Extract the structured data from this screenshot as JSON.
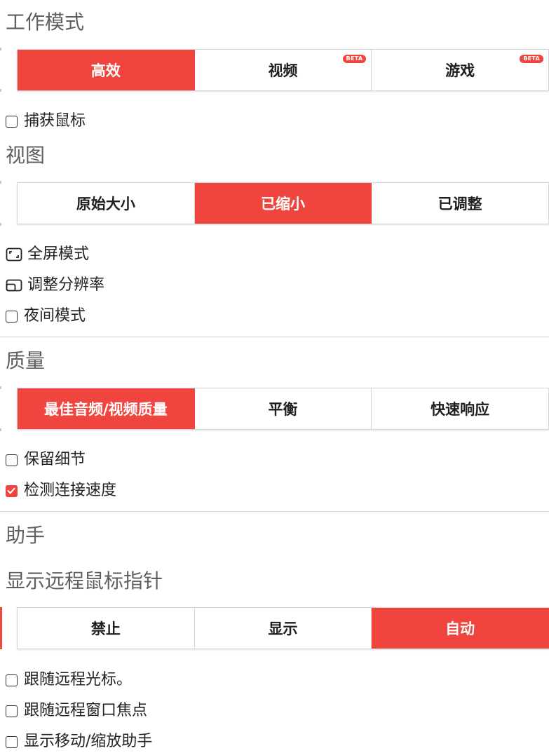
{
  "sections": {
    "work_mode": {
      "title": "工作模式",
      "options": [
        {
          "label": "高效",
          "active": true,
          "badge": ""
        },
        {
          "label": "视频",
          "active": false,
          "badge": "BETA"
        },
        {
          "label": "游戏",
          "active": false,
          "badge": "BETA"
        }
      ],
      "checkboxes": [
        {
          "label": "捕获鼠标",
          "checked": false
        }
      ]
    },
    "view": {
      "title": "视图",
      "options": [
        {
          "label": "原始大小",
          "active": false
        },
        {
          "label": "已缩小",
          "active": true
        },
        {
          "label": "已调整",
          "active": false
        }
      ],
      "fullscreen_label": "全屏模式",
      "resolution_label": "调整分辨率",
      "checkboxes": [
        {
          "label": "夜间模式",
          "checked": false
        }
      ]
    },
    "quality": {
      "title": "质量",
      "options": [
        {
          "label": "最佳音频/视频质量",
          "active": true
        },
        {
          "label": "平衡",
          "active": false
        },
        {
          "label": "快速响应",
          "active": false
        }
      ],
      "checkboxes": [
        {
          "label": "保留细节",
          "checked": false
        },
        {
          "label": "检测连接速度",
          "checked": true
        }
      ]
    },
    "assistant": {
      "title": "助手"
    },
    "remote_pointer": {
      "title": "显示远程鼠标指针",
      "options": [
        {
          "label": "禁止",
          "active": false
        },
        {
          "label": "显示",
          "active": false
        },
        {
          "label": "自动",
          "active": true
        }
      ],
      "checkboxes": [
        {
          "label": "跟随远程光标。",
          "checked": false
        },
        {
          "label": "跟随远程窗口焦点",
          "checked": false
        },
        {
          "label": "显示移动/缩放助手",
          "checked": false
        }
      ]
    }
  },
  "colors": {
    "accent": "#ef453e",
    "heading": "#5f5f5f",
    "text": "#222222",
    "border": "#d6d6d6"
  },
  "icons": {
    "fullscreen": "fullscreen-icon",
    "resolution": "resize-window-icon",
    "check": "checkmark-icon"
  }
}
